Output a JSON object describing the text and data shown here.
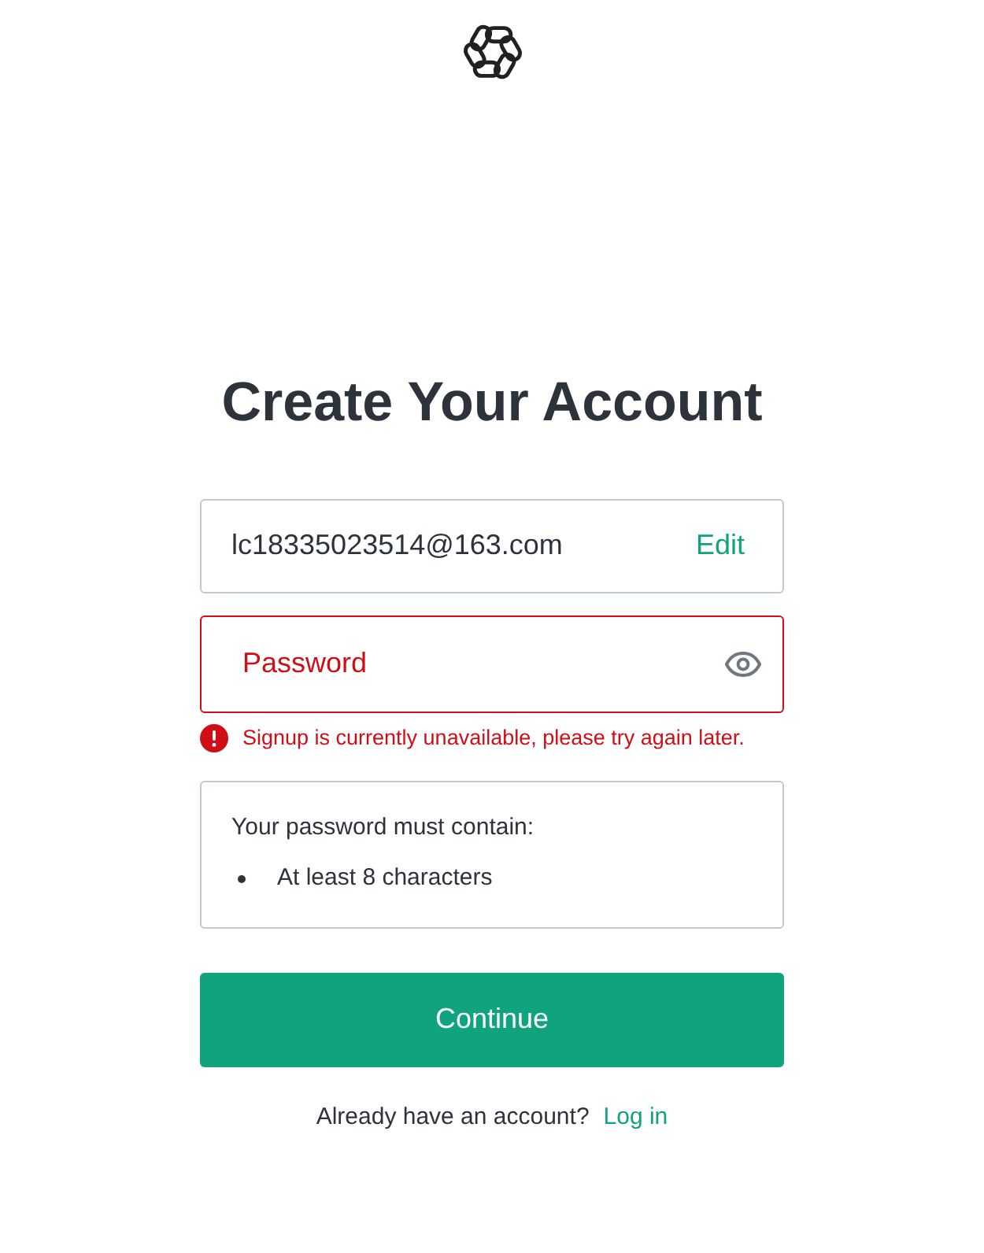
{
  "title": "Create Your Account",
  "email_field": {
    "value": "lc18335023514@163.com",
    "action": "Edit"
  },
  "password_field": {
    "placeholder": "Password",
    "error": true
  },
  "error_message": "Signup is currently unavailable, please try again later.",
  "requirements": {
    "heading": "Your password must contain:",
    "items": [
      "At least 8 characters"
    ]
  },
  "continue_button": "Continue",
  "login_prompt": {
    "text": "Already have an account?",
    "link": "Log in"
  }
}
